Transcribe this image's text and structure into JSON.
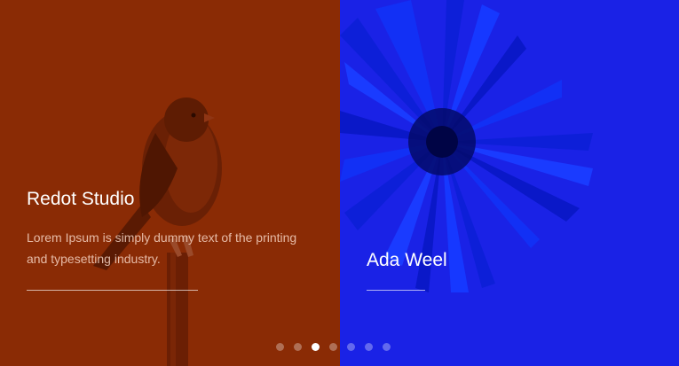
{
  "slides": [
    {
      "title": "Redot Studio",
      "description": "Lorem Ipsum is simply dummy text of the printing and typesetting industry.",
      "background_color": "#8a2b05"
    },
    {
      "title": "Ada Weel",
      "background_color": "#1a22e6"
    }
  ],
  "pagination": {
    "count": 7,
    "active_index": 2
  }
}
